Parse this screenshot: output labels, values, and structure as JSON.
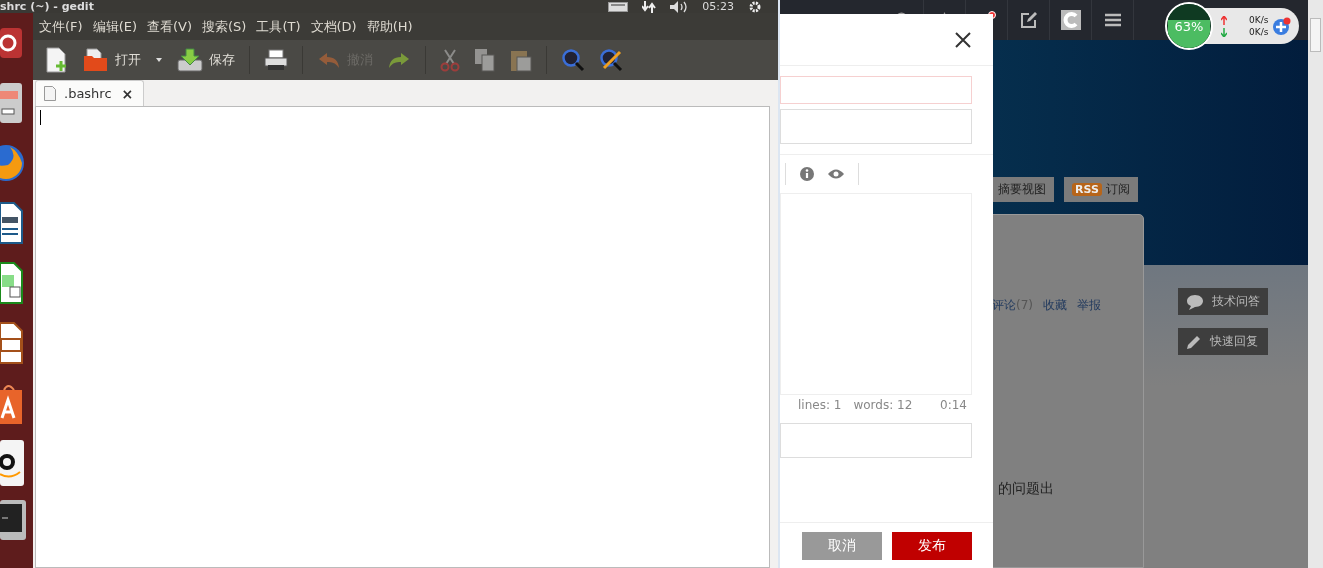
{
  "panel": {
    "title": "shrc (~) - gedit",
    "clock": "05:23"
  },
  "menu": [
    "文件(F)",
    "编辑(E)",
    "查看(V)",
    "搜索(S)",
    "工具(T)",
    "文档(D)",
    "帮助(H)"
  ],
  "toolbar": [
    {
      "kind": "new",
      "disabled": false
    },
    {
      "kind": "open",
      "label": "打开",
      "disabled": false
    },
    {
      "kind": "dropdown",
      "disabled": false
    },
    {
      "kind": "save",
      "label": "保存",
      "disabled": false
    },
    {
      "kind": "separator"
    },
    {
      "kind": "print",
      "disabled": false
    },
    {
      "kind": "separator"
    },
    {
      "kind": "undo",
      "label": "撤消",
      "disabled": true
    },
    {
      "kind": "redo",
      "disabled": false
    },
    {
      "kind": "separator"
    },
    {
      "kind": "cut",
      "disabled": true
    },
    {
      "kind": "copy",
      "disabled": true
    },
    {
      "kind": "paste",
      "disabled": true
    },
    {
      "kind": "separator"
    },
    {
      "kind": "find",
      "disabled": false
    },
    {
      "kind": "replace",
      "disabled": false
    }
  ],
  "tabs": [
    {
      "label": ".bashrc",
      "close": "×",
      "selected": true
    }
  ],
  "browser": {
    "speed_widget": {
      "percent": "63%",
      "level": 0.63,
      "up": "0K/s",
      "down": "0K/s"
    },
    "view_buttons": [
      {
        "label": "摘要视图"
      },
      {
        "badge": "RSS",
        "label": "订阅"
      }
    ],
    "post_links": [
      {
        "label": "评论",
        "count": "(7)"
      },
      {
        "label": "收藏"
      },
      {
        "label": "举报"
      }
    ],
    "body_text": "的问题出",
    "side_buttons": [
      {
        "kind": "comment",
        "label": "技术问答"
      },
      {
        "kind": "edit",
        "label": "快速回复"
      }
    ]
  },
  "dialog": {
    "lines": "lines: 1",
    "words": "words: 12",
    "time": "0:14",
    "buttons": [
      {
        "kind": "secondary",
        "label": "取消"
      },
      {
        "kind": "primary",
        "label": "发布"
      }
    ]
  }
}
